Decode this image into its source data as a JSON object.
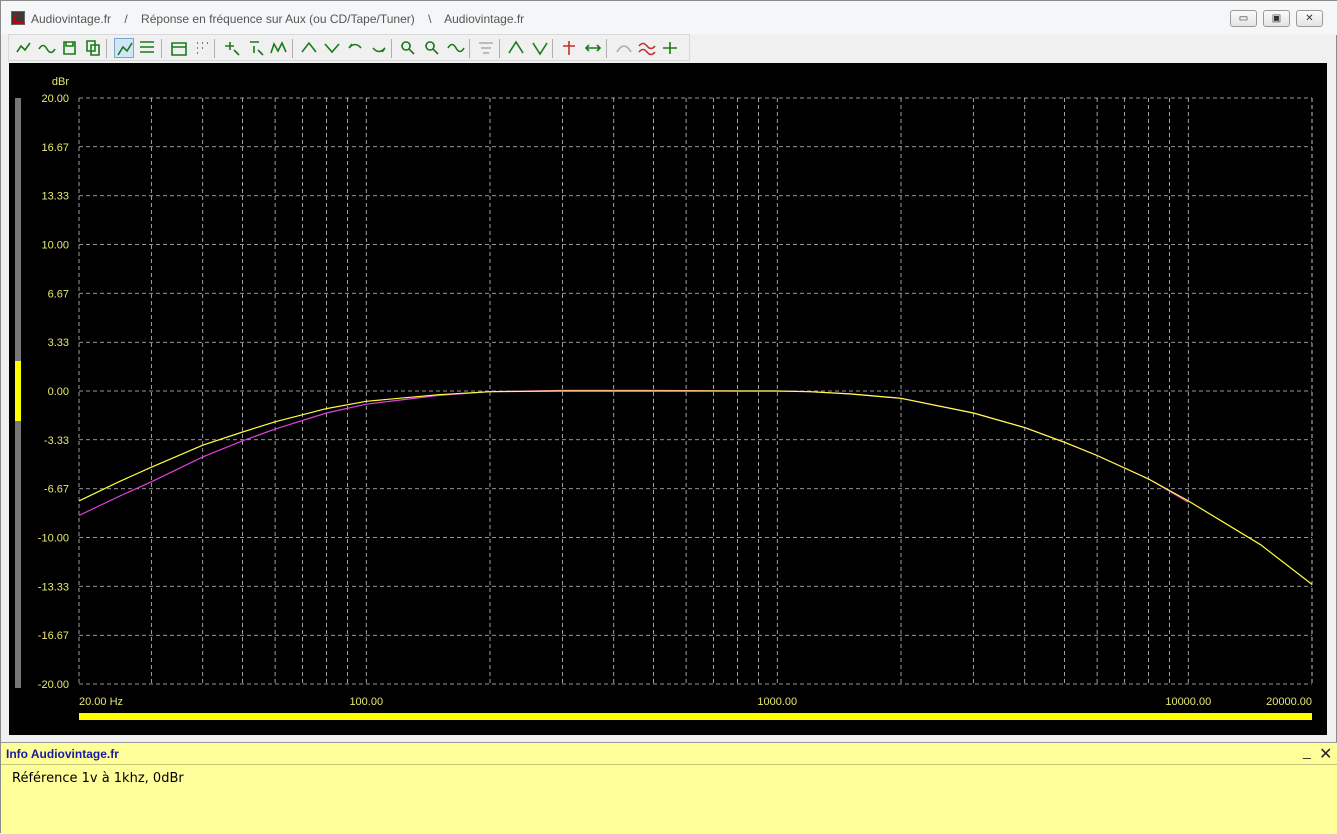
{
  "window": {
    "title": "Audiovintage.fr    /    Réponse en fréquence sur Aux (ou CD/Tape/Tuner)    \\    Audiovintage.fr",
    "app_icon": "graph-app-icon",
    "controls": {
      "minimize": "▭",
      "maximize": "▣",
      "close": "✕"
    }
  },
  "toolbar": {
    "icons": [
      "curve-add-icon",
      "curve-wave-icon",
      "save-icon",
      "copy-icon",
      "graph-active-icon",
      "graph-settings-icon",
      "calendar-icon",
      "grid-dots-icon",
      "zoom-x-icon",
      "zoom-y-icon",
      "sweep-icon",
      "marker-up-icon",
      "marker-down-icon",
      "marker-left-icon",
      "marker-right-icon",
      "zoom-in-icon",
      "zoom-out-icon",
      "sine-icon",
      "disabled-tool-icon",
      "peak-up-icon",
      "peak-down-icon",
      "pin-icon",
      "arrows-icon",
      "disabled-curve-icon",
      "compare-icon",
      "measure-icon"
    ],
    "active_index": 4
  },
  "info_panel": {
    "title": "Info Audiovintage.fr",
    "minimize": "_",
    "close": "✕",
    "text": "Référence 1v à 1khz, 0dBr"
  },
  "colors": {
    "plot_bg": "#000000",
    "grid": "#c8c8c8",
    "axis_text": "#e8e870",
    "trace_yellow": "#ffff40",
    "trace_magenta": "#e040e0",
    "accent_bar": "#ffff00",
    "info_bg": "#ffff99"
  },
  "chart_data": {
    "type": "line",
    "ylabel": "dBr",
    "x_scale": "log",
    "xlim": [
      20,
      20000
    ],
    "ylim": [
      -20,
      20
    ],
    "y_ticks": [
      "20.00",
      "16.67",
      "13.33",
      "10.00",
      "6.67",
      "3.33",
      "0.00",
      "-3.33",
      "-6.67",
      "-10.00",
      "-13.33",
      "-16.67",
      "-20.00"
    ],
    "x_tick_labels": [
      {
        "x": 20,
        "label": "20.00 Hz"
      },
      {
        "x": 100,
        "label": "100.00"
      },
      {
        "x": 1000,
        "label": "1000.00"
      },
      {
        "x": 10000,
        "label": "10000.00"
      },
      {
        "x": 20000,
        "label": "20000.00"
      }
    ],
    "grid": true,
    "series": [
      {
        "color": "#ffff40",
        "x": [
          20,
          25,
          30,
          40,
          50,
          60,
          80,
          100,
          150,
          200,
          300,
          500,
          800,
          1000,
          1200,
          1500,
          2000,
          3000,
          4000,
          5000,
          6000,
          8000,
          10000,
          15000,
          20000
        ],
        "y": [
          -7.5,
          -6.2,
          -5.2,
          -3.7,
          -2.8,
          -2.1,
          -1.2,
          -0.7,
          -0.25,
          -0.05,
          0,
          0,
          0,
          0,
          -0.05,
          -0.2,
          -0.5,
          -1.5,
          -2.5,
          -3.5,
          -4.4,
          -6.0,
          -7.5,
          -10.5,
          -13.2
        ]
      },
      {
        "color": "#e040e0",
        "x": [
          20,
          25,
          30,
          40,
          50,
          60,
          80,
          100,
          150,
          200,
          300,
          500,
          800,
          1000,
          1200,
          1500,
          2000,
          3000,
          4000,
          5000,
          6000,
          8000,
          10000
        ],
        "y": [
          -8.5,
          -7.2,
          -6.2,
          -4.5,
          -3.4,
          -2.6,
          -1.5,
          -0.9,
          -0.3,
          -0.05,
          0.05,
          0.05,
          0,
          0,
          -0.05,
          -0.2,
          -0.5,
          -1.5,
          -2.5,
          -3.5,
          -4.4,
          -6.0,
          -7.6
        ]
      }
    ]
  }
}
